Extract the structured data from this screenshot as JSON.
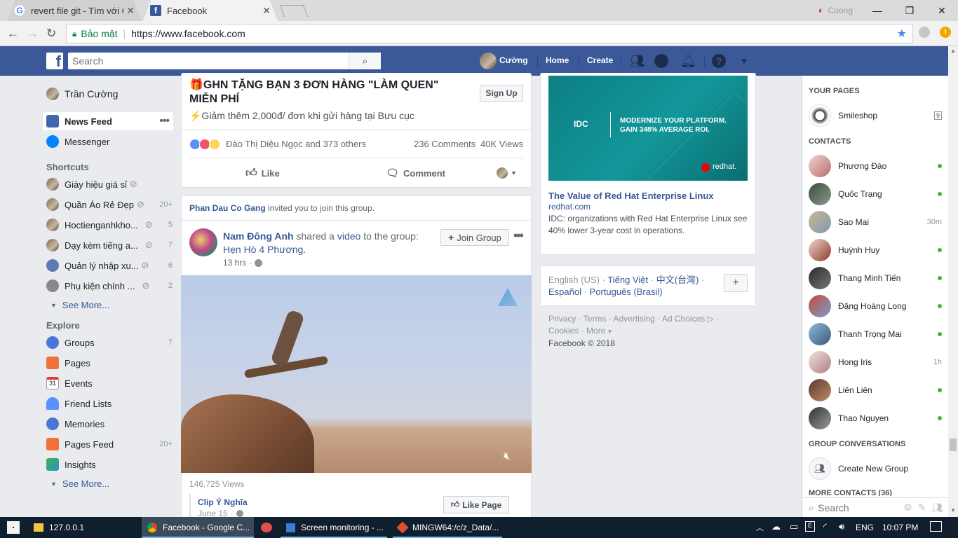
{
  "browser": {
    "tabs": [
      {
        "title": "revert file git - Tìm với Gc",
        "icon": "google-icon"
      },
      {
        "title": "Facebook",
        "icon": "facebook-icon"
      }
    ],
    "profile_name": "Cuong",
    "security_label": "Bảo mật",
    "url": "https://www.facebook.com"
  },
  "fb_header": {
    "search_placeholder": "Search",
    "user_name": "Cường",
    "home": "Home",
    "create": "Create"
  },
  "left_nav": {
    "profile": "Trần Cường",
    "news_feed": "News Feed",
    "messenger": "Messenger",
    "shortcuts_title": "Shortcuts",
    "shortcuts": [
      {
        "label": "Giày hiệu giá sỉ",
        "count": ""
      },
      {
        "label": "Quần Áo Rẻ Đẹp",
        "count": "20+"
      },
      {
        "label": "Hoctienganhkho...",
        "count": "5"
      },
      {
        "label": "Dạy kèm tiếng a...",
        "count": "7"
      },
      {
        "label": "Quản lý nhập xu...",
        "count": "6"
      },
      {
        "label": "Phụ kiện chính ...",
        "count": "2"
      }
    ],
    "see_more": "See More...",
    "explore_title": "Explore",
    "explore": [
      {
        "label": "Groups",
        "count": "7",
        "icon": "groups-icon"
      },
      {
        "label": "Pages",
        "count": "",
        "icon": "pages-flag-icon"
      },
      {
        "label": "Events",
        "count": "",
        "icon": "calendar-icon"
      },
      {
        "label": "Friend Lists",
        "count": "",
        "icon": "friend-lists-icon"
      },
      {
        "label": "Memories",
        "count": "",
        "icon": "clock-icon"
      },
      {
        "label": "Pages Feed",
        "count": "20+",
        "icon": "pages-feed-icon"
      },
      {
        "label": "Insights",
        "count": "",
        "icon": "cube-icon"
      }
    ],
    "see_more2": "See More..."
  },
  "post1": {
    "title": "🎁GHN TẶNG BẠN 3 ĐƠN HÀNG \"LÀM QUEN\" MIỄN PHÍ",
    "subtitle": "⚡Giảm thêm 2,000đ/ đơn khi gửi hàng tại Bưu cục",
    "signup": "Sign Up",
    "reactions": "Đào Thị Diệu Ngọc and 373 others",
    "comments": "236 Comments",
    "views": "40K Views",
    "like": "Like",
    "comment": "Comment"
  },
  "post2": {
    "invite_name": "Phan Dau Co Gang",
    "invite_text": " invited you to join this group.",
    "author": "Nam Đông Anh",
    "shared": " shared a ",
    "video_word": "video",
    "to_group": " to the group:",
    "group_name": "Hẹn Hò 4 Phương.",
    "time": "13 hrs",
    "join": "Join Group",
    "video_views": "146,725 Views",
    "page_name": "Clip Ý Nghĩa",
    "page_date": "June 15",
    "like_page": "Like Page"
  },
  "ad": {
    "banner_logo": "IDC",
    "banner_text": "MODERNIZE YOUR PLATFORM. GAIN 348% AVERAGE ROI.",
    "banner_brand": "redhat.",
    "title": "The Value of Red Hat Enterprise Linux",
    "domain": "redhat.com",
    "desc": "IDC: organizations with Red Hat Enterprise Linux see 40% lower 3-year cost in operations."
  },
  "languages": {
    "current": "English (US)",
    "others": [
      "Tiếng Việt",
      "中文(台灣)",
      "Español",
      "Português (Brasil)"
    ]
  },
  "footer": {
    "links": [
      "Privacy",
      "Terms",
      "Advertising",
      "Ad Choices",
      "Cookies",
      "More"
    ],
    "copyright": "Facebook © 2018"
  },
  "chat": {
    "your_pages": "YOUR PAGES",
    "page": {
      "name": "Smileshop",
      "badge": "9"
    },
    "contacts_title": "CONTACTS",
    "contacts": [
      {
        "name": "Phương Đào",
        "status": "online"
      },
      {
        "name": "Quốc Trạng",
        "status": "online"
      },
      {
        "name": "Sao Mai",
        "status": "30m"
      },
      {
        "name": "Huỳnh Huy",
        "status": "online"
      },
      {
        "name": "Thang Minh Tiến",
        "status": "online"
      },
      {
        "name": "Đặng Hoàng Long",
        "status": "online"
      },
      {
        "name": "Thanh Trọng Mai",
        "status": "online"
      },
      {
        "name": "Hong Iris",
        "status": "1h"
      },
      {
        "name": "Liên Liên",
        "status": "online"
      },
      {
        "name": "Thao Nguyen",
        "status": "online"
      }
    ],
    "group_conv": "GROUP CONVERSATIONS",
    "create_group": "Create New Group",
    "more_contacts": "MORE CONTACTS (36)",
    "search_placeholder": "Search"
  },
  "taskbar": {
    "items": [
      "127.0.0.1",
      "Facebook - Google C...",
      "Screen monitoring - ...",
      "MINGW64:/c/z_Data/..."
    ],
    "lang": "ENG",
    "time": "10:07 PM"
  },
  "colors": {
    "fb_blue": "#3b5998",
    "link": "#365899",
    "online": "#42b72a"
  }
}
